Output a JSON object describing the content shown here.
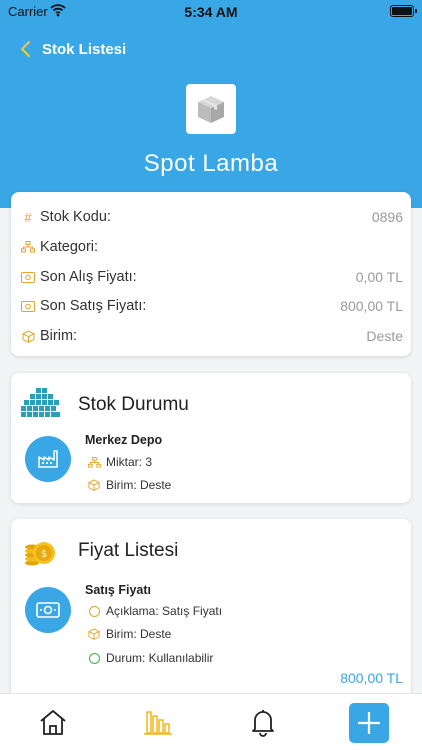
{
  "status_bar": {
    "carrier": "Carrier",
    "time": "5:34 AM"
  },
  "nav": {
    "back_label": "Stok Listesi"
  },
  "product": {
    "name": "Spot Lamba"
  },
  "info": {
    "rows": [
      {
        "icon": "hash-icon",
        "label": "Stok Kodu:",
        "value": "0896"
      },
      {
        "icon": "category-icon",
        "label": "Kategori:",
        "value": ""
      },
      {
        "icon": "money-icon",
        "label": "Son Alış Fiyatı:",
        "value": "0,00 TL"
      },
      {
        "icon": "money-icon",
        "label": "Son Satış Fiyatı:",
        "value": "800,00 TL"
      },
      {
        "icon": "box-icon",
        "label": "Birim:",
        "value": "Deste"
      }
    ]
  },
  "stock": {
    "title": "Stok Durumu",
    "warehouse": "Merkez Depo",
    "quantity": "Miktar: 3",
    "unit": "Birim: Deste"
  },
  "prices": {
    "title": "Fiyat Listesi",
    "item_title": "Satış Fiyatı",
    "description": "Açıklama: Satış Fiyatı",
    "unit": "Birim: Deste",
    "status": "Durum: Kullanılabilir",
    "amount": "800,00 TL"
  },
  "tabbar": {
    "tabs": [
      {
        "icon": "home-icon"
      },
      {
        "icon": "bar-chart-icon"
      },
      {
        "icon": "bell-icon"
      },
      {
        "icon": "plus-icon"
      }
    ]
  },
  "colors": {
    "primary": "#39a7e6",
    "accent": "#e3a52b",
    "success": "#3cb54a"
  }
}
